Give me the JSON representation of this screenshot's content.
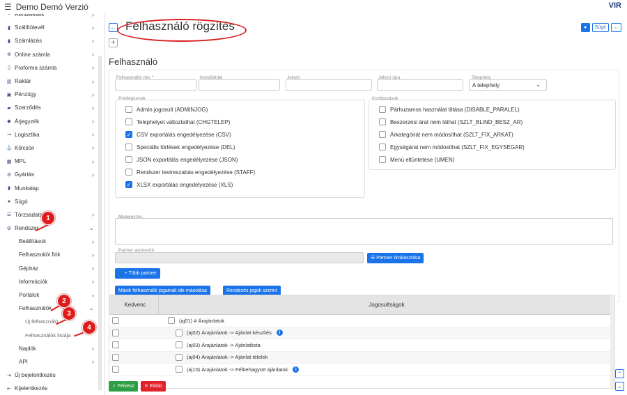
{
  "app": {
    "title": "Demo Demó Verzió",
    "logo": "VIR"
  },
  "sidebar": {
    "items": [
      {
        "label": "Rendelések",
        "icon": "list-icon"
      },
      {
        "label": "Szállítólevél",
        "icon": "doc-icon"
      },
      {
        "label": "Számlázás",
        "icon": "doc-icon"
      },
      {
        "label": "Online számla",
        "icon": "globe-icon"
      },
      {
        "label": "Proforma számla",
        "icon": "doc-outline-icon"
      },
      {
        "label": "Raktár",
        "icon": "warehouse-icon"
      },
      {
        "label": "Pénzügy",
        "icon": "money-icon"
      },
      {
        "label": "Szerződés",
        "icon": "folder-icon"
      },
      {
        "label": "Árjegyzék",
        "icon": "tag-icon"
      },
      {
        "label": "Logisztika",
        "icon": "route-icon"
      },
      {
        "label": "Kölcsön",
        "icon": "hand-icon"
      },
      {
        "label": "MPL",
        "icon": "mpl-icon"
      },
      {
        "label": "Gyártás",
        "icon": "gears-icon"
      },
      {
        "label": "Munkalap",
        "icon": "doc-icon"
      },
      {
        "label": "Súgó",
        "icon": "help-icon"
      },
      {
        "label": "Törzsadatok",
        "icon": "database-icon"
      },
      {
        "label": "Rendszer",
        "icon": "settings-icon"
      }
    ],
    "system_sub": [
      {
        "label": "Beállítások"
      },
      {
        "label": "Felhasználói fiók"
      },
      {
        "label": "Gépház"
      },
      {
        "label": "Információk"
      },
      {
        "label": "Portálok"
      },
      {
        "label": "Felhasználók"
      }
    ],
    "users_sub": [
      {
        "label": "Új felhasználó"
      },
      {
        "label": "Felhasználók listája"
      }
    ],
    "tail": [
      {
        "label": "Naplók"
      },
      {
        "label": "API"
      }
    ],
    "bottom": [
      {
        "label": "Új bejelentkezés",
        "icon": "login-icon"
      },
      {
        "label": "Kijelentkezés",
        "icon": "logout-icon"
      }
    ]
  },
  "annotations": [
    "1",
    "2",
    "3",
    "4"
  ],
  "header": {
    "title": "Felhasználó rögzítés",
    "help_label": "Súgó"
  },
  "form": {
    "section_title": "Felhasználó",
    "username_label": "Felhasználói név *",
    "start_page_label": "Kezdőoldal",
    "password_label": "Jelszó",
    "password2_label": "Jelszó újra",
    "site_label": "Telephely",
    "site_value": "A telephely",
    "privileges_label": "Privilégiumok",
    "privileges": [
      {
        "label": "Admin jogosult (ADMINJOG)",
        "checked": false
      },
      {
        "label": "Telephelyet változtathat (CHGTELEP)",
        "checked": false
      },
      {
        "label": "CSV exportálás engedélyezése (CSV)",
        "checked": true
      },
      {
        "label": "Speciális törlések engedélyezése (DEL)",
        "checked": false
      },
      {
        "label": "JSON exportálás engedélyezése (JSON)",
        "checked": false
      },
      {
        "label": "Rendszer testreszabás engedélyezése (STAFF)",
        "checked": false
      },
      {
        "label": "XLSX exportálás engedélyezése (XLS)",
        "checked": true
      }
    ],
    "restrictions_label": "Korlátozások",
    "restrictions": [
      {
        "label": "Párhuzamos használat tiltása (DISABLE_PARALEL)",
        "checked": false
      },
      {
        "label": "Beszerzési árat nem láthat (SZLT_BLIND_BESZ_AR)",
        "checked": false
      },
      {
        "label": "Árkategóriát nem módosíthat (SZLT_FIX_ARKAT)",
        "checked": false
      },
      {
        "label": "Egységárat nem módosíthat (SZLT_FIX_EGYSEGAR)",
        "checked": false
      },
      {
        "label": "Menü eltüntetése (UMEN)",
        "checked": false
      }
    ],
    "note_label": "Megjegyzés",
    "partner_id_label": "Partner azonosító",
    "partner_select_label": "Partner kiválasztása",
    "more_partner_label": "Több partner",
    "copy_rights_label": "Másik felhasználó jogainak ide másolása",
    "sort_rights_label": "Rendezés jogok szerint"
  },
  "grid": {
    "col_fav": "Kedvenc",
    "col_rights": "Jogosultságok",
    "rows": [
      {
        "label": "(aj01) # Árajánlatok",
        "indent": 0,
        "info": false
      },
      {
        "label": "(aj02)  Árajánlatok -> Ajánlat készítés",
        "indent": 1,
        "info": true
      },
      {
        "label": "(aj03)  Árajánlatok -> Ajánlatlista",
        "indent": 1,
        "info": false
      },
      {
        "label": "(aj04)  Árajánlatok -> Ajánlat tételek",
        "indent": 1,
        "info": false
      },
      {
        "label": "(aj10)  Árajánlatok -> Félbehagyott ajánlatok",
        "indent": 1,
        "info": true
      }
    ]
  },
  "footer": {
    "save_label": "Felvesz",
    "discard_label": "Eldob"
  }
}
